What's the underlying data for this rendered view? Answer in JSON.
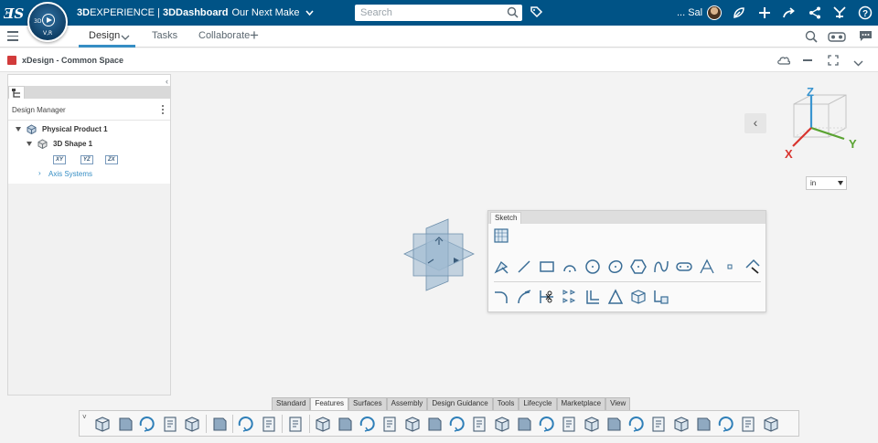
{
  "topbar": {
    "logo_text": "3DS",
    "compass": {
      "labels": [
        "3D",
        "V,R"
      ],
      "icon": "compass-play-icon"
    },
    "brand_bold": "3D",
    "brand_light": "EXPERIENCE",
    "brand_sep": " | ",
    "brand_app": "3DDashboard",
    "context": "Our Next Make",
    "search_placeholder": "Search",
    "user_name": "... Sal",
    "icons": [
      "tag-icon",
      "search-icon",
      "avatar",
      "feather-icon",
      "plus-icon",
      "share-arrow-icon",
      "network-icon",
      "tools-icon",
      "help-icon"
    ]
  },
  "tabbar": {
    "tabs": [
      {
        "label": "Design",
        "active": true
      },
      {
        "label": "Tasks",
        "active": false
      },
      {
        "label": "Collaborate",
        "active": false
      }
    ],
    "add_label": "+",
    "right_icons": [
      "find-icon",
      "vr-icon",
      "chat-icon"
    ]
  },
  "appbar": {
    "title": "xDesign - Common Space",
    "right_icons": [
      "cloud-icon",
      "minimize-icon",
      "fullscreen-icon",
      "chevron-down-icon"
    ]
  },
  "design_manager": {
    "header": "Design Manager",
    "tree": {
      "root": "Physical Product 1",
      "child": "3D Shape 1",
      "planes": [
        "XY",
        "YZ",
        "ZX"
      ],
      "axis_systems": "Axis Systems"
    }
  },
  "viewport": {
    "triad": {
      "x": "X",
      "y": "Y",
      "z": "Z"
    },
    "unit": "in",
    "colors": {
      "x": "#d8342f",
      "y": "#5aa332",
      "z": "#3a95d0",
      "plane": "#8fb0c8"
    }
  },
  "sketch_panel": {
    "tab": "Sketch",
    "rows": [
      [
        "sketch-grid-icon"
      ],
      [
        "sketch-edit-icon",
        "line-icon",
        "rectangle-icon",
        "arc-icon",
        "circle-icon",
        "ellipse-icon",
        "polygon-icon",
        "spline-icon",
        "slot-icon",
        "text-icon",
        "point-icon",
        "construction-icon"
      ],
      [
        "fillet-icon",
        "offset-arc-icon",
        "trim-icon",
        "pattern-icon",
        "offset-icon",
        "triangle-icon",
        "project-icon",
        "convert-icon"
      ]
    ]
  },
  "command_tabs": [
    "Standard",
    "Features",
    "Surfaces",
    "Assembly",
    "Design Guidance",
    "Tools",
    "Lifecycle",
    "Marketplace",
    "View"
  ],
  "active_command_tab": "Features",
  "command_bar": {
    "groups": [
      [
        "new-icon",
        "open-icon",
        "save-icon",
        "refresh-icon",
        "clipboard-icon"
      ],
      [
        "settings-icon"
      ],
      [
        "undo-icon",
        "redo-icon"
      ],
      [
        "help-icon"
      ],
      [
        "sketch-cube-icon",
        "extrude-icon",
        "revolve-icon",
        "sweep-icon",
        "loft-icon",
        "cut-icon",
        "hole-icon",
        "shell-icon",
        "draft-icon",
        "fillet-feature-icon",
        "chamfer-icon",
        "mirror-icon",
        "pattern-feature-icon",
        "sheet-metal-icon",
        "flange-icon",
        "bend-icon",
        "boolean-icon",
        "split-icon",
        "thicken-icon",
        "surface-icon",
        "scale-icon"
      ]
    ]
  }
}
